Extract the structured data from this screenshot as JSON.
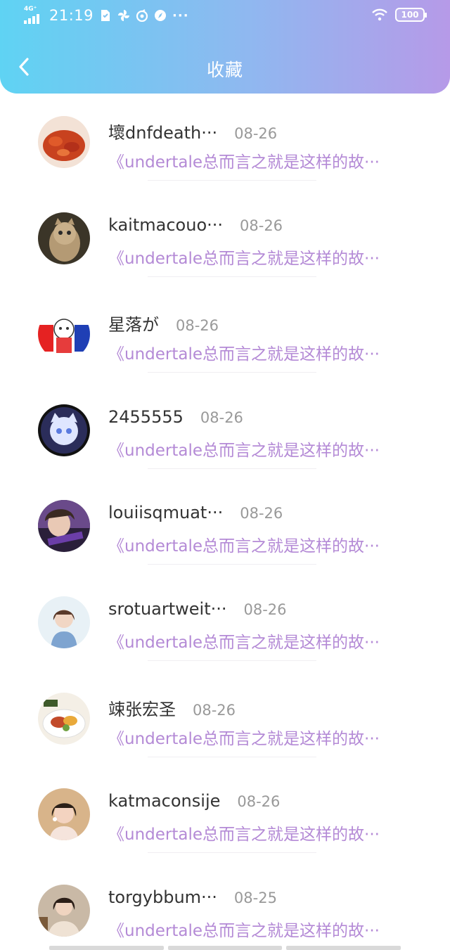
{
  "status_bar": {
    "network": "4G⁺",
    "time": "21:19",
    "battery": "100",
    "more": "···"
  },
  "header": {
    "title": "收藏"
  },
  "items": [
    {
      "name": "壞dnfdeath···",
      "date": "08-26",
      "snippet": "《undertale总而言之就是这样的故···"
    },
    {
      "name": "kaitmacouo···",
      "date": "08-26",
      "snippet": "《undertale总而言之就是这样的故···"
    },
    {
      "name": "星落が",
      "date": "08-26",
      "snippet": "《undertale总而言之就是这样的故···"
    },
    {
      "name": "2455555",
      "date": "08-26",
      "snippet": "《undertale总而言之就是这样的故···"
    },
    {
      "name": "louiisqmuat···",
      "date": "08-26",
      "snippet": "《undertale总而言之就是这样的故···"
    },
    {
      "name": "srotuartweit···",
      "date": "08-26",
      "snippet": "《undertale总而言之就是这样的故···"
    },
    {
      "name": "竦张宏圣",
      "date": "08-26",
      "snippet": "《undertale总而言之就是这样的故···"
    },
    {
      "name": "katmaconsije",
      "date": "08-26",
      "snippet": "《undertale总而言之就是这样的故···"
    },
    {
      "name": "torgybbum···",
      "date": "08-25",
      "snippet": "《undertale总而言之就是这样的故···"
    }
  ],
  "colors": {
    "header_gradient_start": "#5fd3f3",
    "header_gradient_end": "#b69ae8",
    "snippet": "#b48ad6",
    "date": "#999999",
    "name": "#333333"
  },
  "icons": [
    "signal-icon",
    "sim-card-icon",
    "pinwheel-icon",
    "netease-music-icon",
    "compass-icon",
    "wifi-icon",
    "battery-icon",
    "back-chevron-icon"
  ]
}
